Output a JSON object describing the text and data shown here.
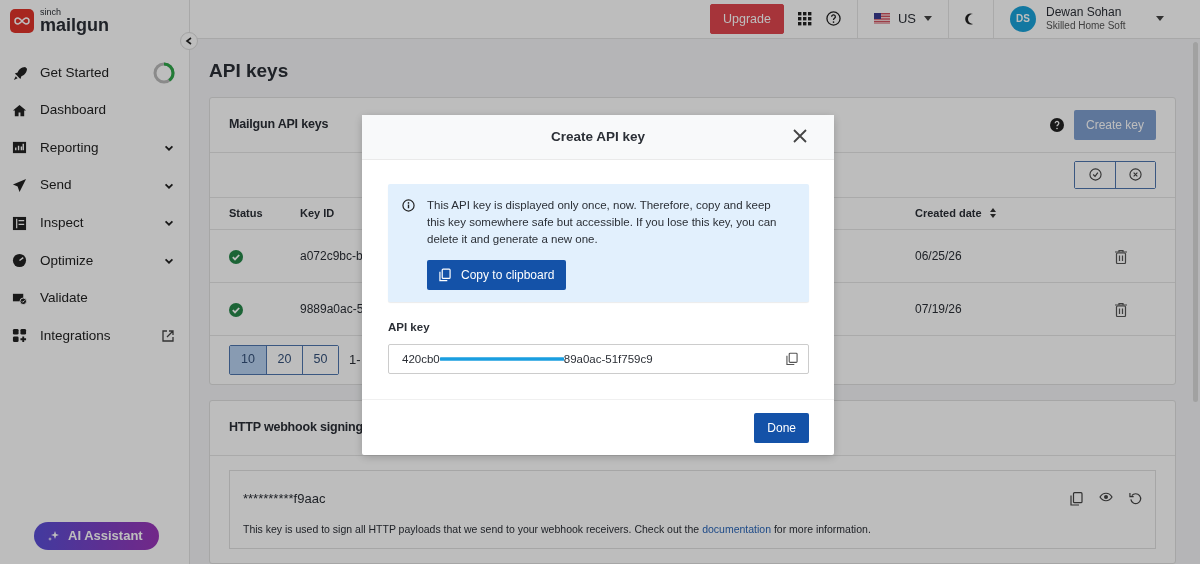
{
  "brand": {
    "small": "sinch",
    "name": "mailgun"
  },
  "topbar": {
    "upgrade": "Upgrade",
    "region": "US",
    "avatar": "DS",
    "user_name": "Dewan Sohan",
    "org": "Skilled Home Soft"
  },
  "sidebar": {
    "items": [
      {
        "label": "Get Started",
        "kind": "progress",
        "level": 0.4
      },
      {
        "label": "Dashboard",
        "kind": "plain"
      },
      {
        "label": "Reporting",
        "kind": "expandable"
      },
      {
        "label": "Send",
        "kind": "expandable"
      },
      {
        "label": "Inspect",
        "kind": "expandable"
      },
      {
        "label": "Optimize",
        "kind": "expandable"
      },
      {
        "label": "Validate",
        "kind": "plain"
      },
      {
        "label": "Integrations",
        "kind": "external"
      }
    ],
    "assistant": "AI Assistant"
  },
  "page": {
    "title": "API keys"
  },
  "api_keys_card": {
    "title": "Mailgun API keys",
    "create_button": "Create key",
    "columns": [
      "Status",
      "Key ID",
      "Created date"
    ],
    "rows": [
      {
        "active": true,
        "key_id": "a072c9bc-b",
        "created": "06/25/26"
      },
      {
        "active": true,
        "key_id": "9889a0ac-5",
        "created": "07/19/26"
      }
    ],
    "page_sizes": [
      {
        "label": "10",
        "selected": true
      },
      {
        "label": "20",
        "selected": false
      },
      {
        "label": "50",
        "selected": false
      }
    ],
    "range": "1-"
  },
  "webhook_card": {
    "title": "HTTP webhook signing",
    "masked_key": "**********f9aac",
    "description_before": "This key is used to sign all HTTP payloads that we send to your webhook receivers. Check out the ",
    "link": "documentation",
    "description_after": " for more information."
  },
  "dialog": {
    "title": "Create API key",
    "notice": "This API key is displayed only once, now. Therefore, copy and keep this key somewhere safe but accessible. If you lose this key, you can delete it and generate a new one.",
    "copy_button": "Copy to clipboard",
    "field_label": "API key",
    "key_start": "420cb0",
    "key_end": "89a0ac-51f759c9",
    "done_button": "Done"
  }
}
